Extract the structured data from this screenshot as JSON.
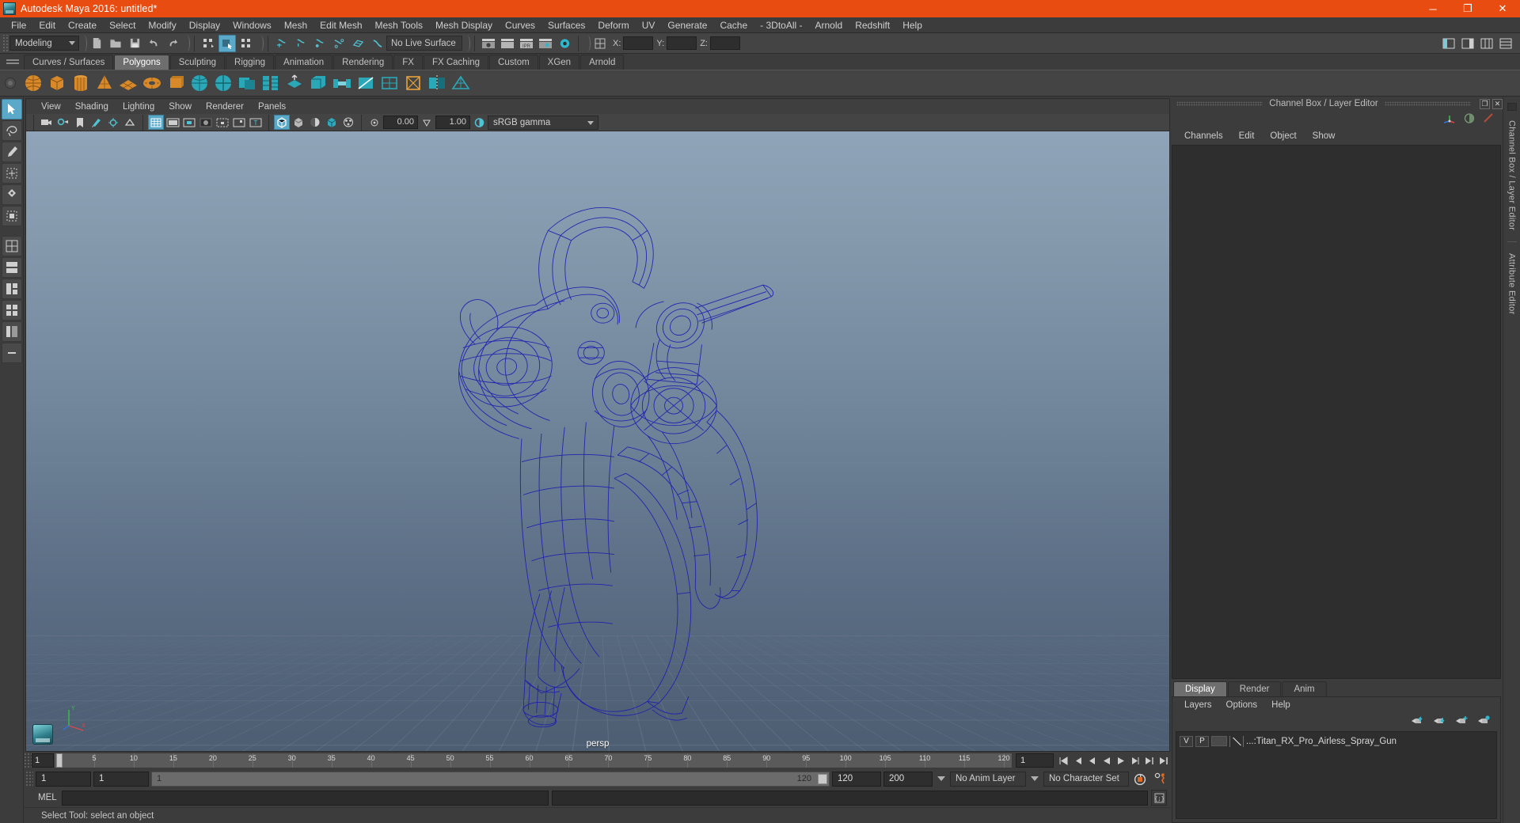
{
  "window": {
    "title": "Autodesk Maya 2016: untitled*",
    "icon": "maya-logo-icon",
    "controls": {
      "minimize": "─",
      "maximize": "❐",
      "close": "✕"
    },
    "titlebar_color": "#e84c11"
  },
  "menubar": {
    "items": [
      "File",
      "Edit",
      "Create",
      "Select",
      "Modify",
      "Display",
      "Windows",
      "Mesh",
      "Edit Mesh",
      "Mesh Tools",
      "Mesh Display",
      "Curves",
      "Surfaces",
      "Deform",
      "UV",
      "Generate",
      "Cache",
      "- 3DtoAll -",
      "Arnold",
      "Redshift",
      "Help"
    ]
  },
  "statusline": {
    "menu_set": "Modeling",
    "live_surface": "No Live Surface",
    "axis_labels": {
      "x": "X:",
      "y": "Y:",
      "z": "Z:"
    },
    "axis_values": {
      "x": "",
      "y": "",
      "z": ""
    },
    "icons": [
      "new-scene-icon",
      "open-scene-icon",
      "save-scene-icon",
      "undo-icon",
      "redo-icon",
      "select-hierarchy-icon",
      "select-object-icon",
      "select-component-icon",
      "snap-to-grid-icon",
      "snap-to-curve-icon",
      "snap-to-point-icon",
      "snap-to-projected-center-icon",
      "snap-to-view-plane-icon",
      "make-live-icon",
      "render-view-icon",
      "render-sequence-icon",
      "ipr-render-icon",
      "render-settings-icon",
      "hypershade-icon",
      "show-editor-icon",
      "open-render-view-icon",
      "toggle-panel-icon",
      "sidebar-toggle-icon",
      "attribute-editor-toggle-icon",
      "tool-settings-toggle-icon",
      "channel-box-toggle-icon"
    ]
  },
  "shelf": {
    "tabs": [
      "Curves / Surfaces",
      "Polygons",
      "Sculpting",
      "Rigging",
      "Animation",
      "Rendering",
      "FX",
      "FX Caching",
      "Custom",
      "XGen",
      "Arnold"
    ],
    "active_tab": "Polygons",
    "items": [
      "poly-sphere-icon",
      "poly-cube-icon",
      "poly-cylinder-icon",
      "poly-cone-icon",
      "poly-torus-icon",
      "poly-plane-icon",
      "poly-disc-icon",
      "poly-platonic-icon",
      "poly-pyramid-icon",
      "poly-prism-icon",
      "poly-pipe-icon",
      "poly-helix-icon",
      "poly-gear-icon",
      "poly-soccer-ball-icon",
      "poly-super-ellipse-icon",
      "poly-sphere-hires-icon",
      "poly-ultra-shape-icon",
      "combine-icon",
      "separate-icon",
      "booleans-icon",
      "smooth-icon",
      "extrude-icon",
      "bevel-icon",
      "bridge-icon",
      "append-icon",
      "wedge-icon",
      "multi-cut-icon",
      "target-weld-icon",
      "quad-draw-icon",
      "mirror-icon",
      "merge-icon",
      "fill-hole-icon",
      "reduce-icon",
      "cut-faces-icon"
    ]
  },
  "toolbox": {
    "items": [
      "select-tool-icon",
      "lasso-select-tool-icon",
      "paint-select-tool-icon",
      "move-tool-icon",
      "rotate-tool-icon",
      "scale-tool-icon",
      "universal-manipulator-icon",
      "soft-modification-icon",
      "show-manipulator-icon",
      "last-tool-used-icon"
    ],
    "active": "select-tool-icon",
    "layouts": [
      "single-view-layout-icon",
      "two-pane-layout-icon",
      "three-pane-layout-icon",
      "four-pane-layout-icon",
      "persp-outliner-layout-icon",
      "hypershade-layout-icon",
      "expand-layouts-icon"
    ]
  },
  "viewport": {
    "menus": [
      "View",
      "Shading",
      "Lighting",
      "Show",
      "Renderer",
      "Panels"
    ],
    "toolbar_icons": [
      "select-camera-icon",
      "camera-attributes-icon",
      "bookmark-icon",
      "image-plane-icon",
      "two-sided-lighting-icon",
      "shadows-icon",
      "grid-toggle-icon",
      "film-gate-icon",
      "resolution-gate-icon",
      "gate-mask-icon",
      "film-origin-icon",
      "xray-icon",
      "texture-icon",
      "wireframe-shaded-icon",
      "smooth-shade-all-icon",
      "shaded-wireframe-icon",
      "hardware-texturing-icon",
      "use-default-material-icon",
      "xray-joints-icon",
      "exposure-icon",
      "gamma-icon"
    ],
    "exposure_value": "0.00",
    "gamma_value": "1.00",
    "color_management": "sRGB gamma",
    "camera_name": "persp",
    "axis_labels": {
      "y": "Y",
      "x": "X",
      "z": "Z"
    },
    "model_name": "Titan RX Pro Airless Spray Gun",
    "wireframe_color": "#1f1fb0",
    "background_top": "#8fa4b8",
    "background_bottom": "#4d5d72"
  },
  "channel_box": {
    "panel_title": "Channel Box / Layer Editor",
    "menus": [
      "Channels",
      "Edit",
      "Object",
      "Show"
    ],
    "header_icons": [
      "channel-box-icon",
      "attribute-editor-icon",
      "modeling-toolkit-icon"
    ],
    "window_buttons": {
      "float": "❐",
      "close": "✕"
    }
  },
  "layer_editor": {
    "tabs": [
      "Display",
      "Render",
      "Anim"
    ],
    "active_tab": "Display",
    "menus": [
      "Layers",
      "Options",
      "Help"
    ],
    "buttons": [
      "move-layer-up-icon",
      "move-layer-down-icon",
      "create-new-layer-icon",
      "create-layer-from-selected-icon"
    ],
    "layers": [
      {
        "visibility": "V",
        "playback": "P",
        "color": "",
        "name": "...:Titan_RX_Pro_Airless_Spray_Gun"
      }
    ]
  },
  "right_tabs": {
    "items": [
      "Channel Box / Layer Editor",
      "Attribute Editor"
    ]
  },
  "timeline": {
    "current_frame": "1",
    "frame_field": "1",
    "ticks": [
      "5",
      "10",
      "15",
      "20",
      "25",
      "30",
      "35",
      "40",
      "45",
      "50",
      "55",
      "60",
      "65",
      "70",
      "75",
      "80",
      "85",
      "90",
      "95",
      "100",
      "105",
      "110",
      "115",
      "120"
    ],
    "tick_values": [
      5,
      10,
      15,
      20,
      25,
      30,
      35,
      40,
      45,
      50,
      55,
      60,
      65,
      70,
      75,
      80,
      85,
      90,
      95,
      100,
      105,
      110,
      115,
      120
    ],
    "range_start": 1,
    "range_end": 120,
    "transport_icons": [
      "go-to-start-icon",
      "step-back-keyframe-icon",
      "step-back-frame-icon",
      "play-backwards-icon",
      "play-forwards-icon",
      "step-forward-frame-icon",
      "step-forward-keyframe-icon",
      "go-to-end-icon"
    ]
  },
  "range_slider": {
    "anim_start": "1",
    "anim_end": "1",
    "range_start_label": "1",
    "range_end_label": "120",
    "playback_end": "120",
    "anim_end_total": "200",
    "anim_layer": "No Anim Layer",
    "character_set": "No Character Set",
    "auto_key_icon": "auto-keyframe-icon",
    "anim_prefs_icon": "animation-preferences-icon"
  },
  "command_line": {
    "label": "MEL",
    "input_value": "",
    "output_value": "",
    "script_editor_icon": "script-editor-icon"
  },
  "help_line": {
    "text": "Select Tool: select an object"
  }
}
